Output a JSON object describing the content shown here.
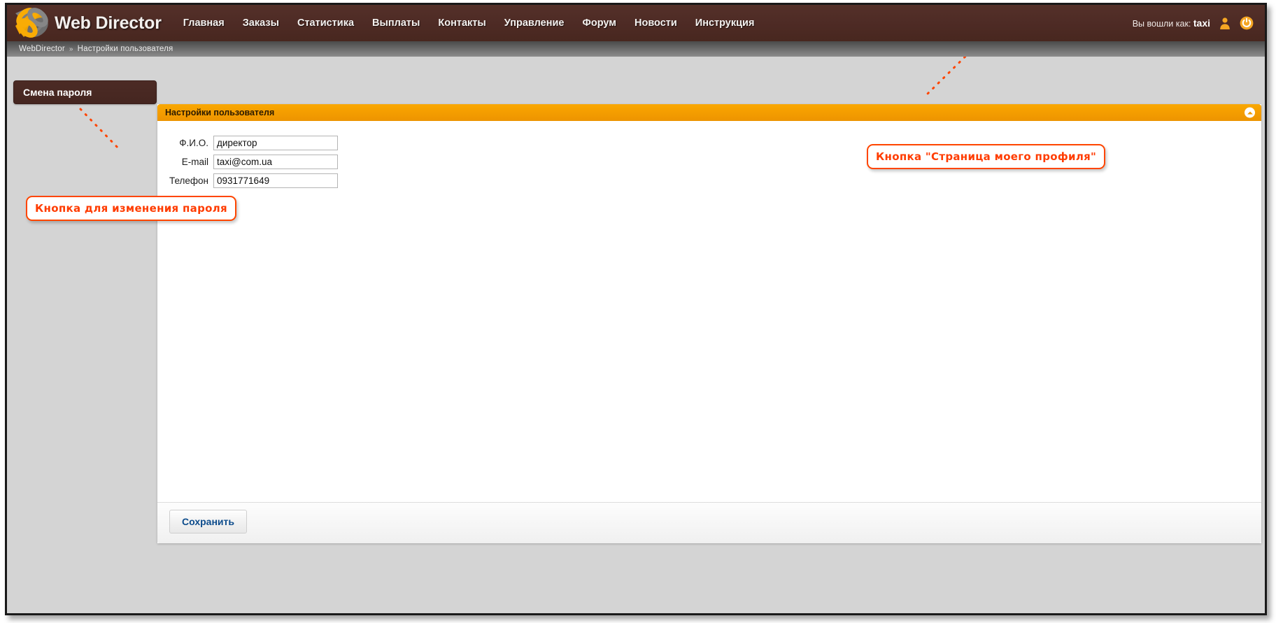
{
  "header": {
    "brand": "Web Director",
    "logo_icon": "interlocking-bands-logo",
    "nav": [
      {
        "label": "Главная"
      },
      {
        "label": "Заказы"
      },
      {
        "label": "Статистика"
      },
      {
        "label": "Выплаты"
      },
      {
        "label": "Контакты"
      },
      {
        "label": "Управление"
      },
      {
        "label": "Форум"
      },
      {
        "label": "Новости"
      },
      {
        "label": "Инструкция"
      }
    ],
    "logged_in_prefix": "Вы вошли как:",
    "logged_in_user": "taxi",
    "profile_icon": "user-profile-icon",
    "logout_icon": "power-logout-icon"
  },
  "breadcrumb": {
    "root": "WebDirector",
    "separator": "»",
    "current": "Настройки пользователя"
  },
  "sidebar": {
    "items": [
      {
        "label": "Смена пароля"
      }
    ]
  },
  "panel": {
    "title": "Настройки пользователя",
    "collapse_icon": "chevron-up-icon",
    "fields": [
      {
        "label": "Ф.И.О.",
        "value": "директор"
      },
      {
        "label": "E-mail",
        "value": "taxi@com.ua"
      },
      {
        "label": "Телефон",
        "value": "0931771649"
      }
    ],
    "save_label": "Сохранить"
  },
  "annotations": [
    {
      "id": "password",
      "text": "Кнопка для изменения пароля"
    },
    {
      "id": "profile",
      "text": "Кнопка \"Страница моего профиля\""
    }
  ],
  "colors": {
    "brand_dark": "#4b2922",
    "accent_orange": "#f59e00",
    "annotation_red": "#ff3c00",
    "page_bg": "#d4d4d4",
    "save_text_blue": "#0d4c8c"
  }
}
